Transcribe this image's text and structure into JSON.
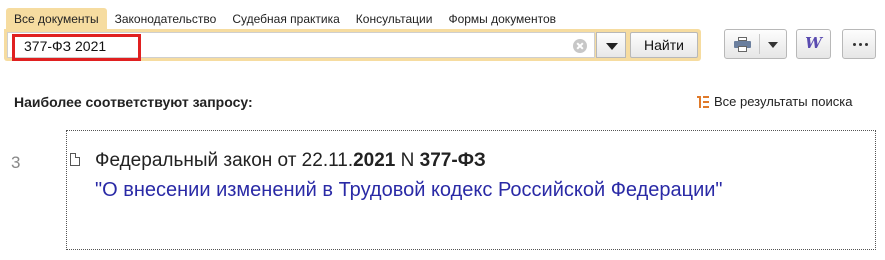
{
  "tabs": [
    {
      "label": "Все документы",
      "active": true
    },
    {
      "label": "Законодательство"
    },
    {
      "label": "Судебная практика"
    },
    {
      "label": "Консультации"
    },
    {
      "label": "Формы документов"
    }
  ],
  "search": {
    "value": "377-ФЗ 2021",
    "find_label": "Найти"
  },
  "toolbar": {
    "word_label": "W"
  },
  "results": {
    "heading": "Наиболее соответствуют запросу:",
    "all_results_label": "Все результаты поиска",
    "items": [
      {
        "number": "3",
        "title_prefix": "Федеральный закон от 22.11.",
        "title_year": "2021",
        "title_mid": " N ",
        "title_num": "377-ФЗ",
        "link": "\"О внесении изменений в Трудовой кодекс Российской Федерации\""
      }
    ]
  },
  "colors": {
    "tab_active": "#f6dca0",
    "highlight_box": "#e02020",
    "link": "#2a2aa6"
  },
  "icons": [
    "clear-icon",
    "dropdown-arrow-icon",
    "printer-icon",
    "word-icon",
    "more-icon",
    "list-icon",
    "document-icon"
  ]
}
